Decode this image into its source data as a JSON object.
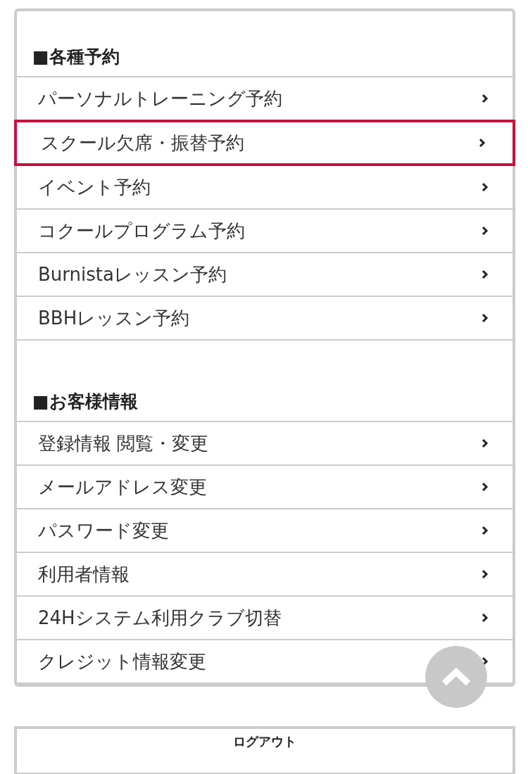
{
  "sections": [
    {
      "heading": "■各種予約",
      "items": [
        {
          "label": "パーソナルトレーニング予約",
          "highlighted": false
        },
        {
          "label": "スクール欠席・振替予約",
          "highlighted": true
        },
        {
          "label": "イベント予約",
          "highlighted": false
        },
        {
          "label": "コクールプログラム予約",
          "highlighted": false
        },
        {
          "label": "Burnistaレッスン予約",
          "highlighted": false
        },
        {
          "label": "BBHレッスン予約",
          "highlighted": false
        }
      ]
    },
    {
      "heading": "■お客様情報",
      "items": [
        {
          "label": "登録情報 閲覧・変更",
          "highlighted": false
        },
        {
          "label": "メールアドレス変更",
          "highlighted": false
        },
        {
          "label": "パスワード変更",
          "highlighted": false
        },
        {
          "label": "利用者情報",
          "highlighted": false
        },
        {
          "label": "24Hシステム利用クラブ切替",
          "highlighted": false
        },
        {
          "label": "クレジット情報変更",
          "highlighted": false
        }
      ]
    }
  ],
  "logout": "ログアウト"
}
